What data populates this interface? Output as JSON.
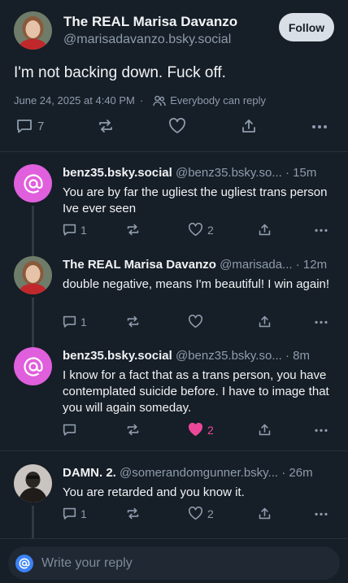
{
  "main_post": {
    "display_name": "The REAL Marisa Davanzo",
    "handle": "@marisadavanzo.bsky.social",
    "follow_label": "Follow",
    "text": "I'm not backing down. Fuck off.",
    "date": "June 24, 2025 at 4:40 PM",
    "reply_setting": "Everybody can reply",
    "reply_count": "7"
  },
  "replies": [
    {
      "display_name": "benz35.bsky.social",
      "handle": "@benz35.bsky.so...",
      "time": "· 15m",
      "text": "You are by far the ugliest the ugliest trans person Ive ever seen",
      "reply_count": "1",
      "like_count": "2",
      "avatar": "at-icon"
    },
    {
      "display_name": "The REAL Marisa Davanzo",
      "handle": "@marisada...",
      "time": "· 12m",
      "text": "double negative, means I'm beautiful! I win again!",
      "reply_count": "1",
      "like_count": "",
      "avatar": "photo"
    },
    {
      "display_name": "benz35.bsky.social",
      "handle": "@benz35.bsky.so...",
      "time": "· 8m",
      "text": "I know for a fact that as a trans person, you have contemplated suicide before. I have to image that you will again someday.",
      "reply_count": "",
      "like_count": "2",
      "liked": true,
      "avatar": "at-icon"
    },
    {
      "display_name": "DAMN. 2.",
      "handle": "@somerandomgunner.bsky...",
      "time": "· 26m",
      "text": "You are retarded and you know it.",
      "reply_count": "1",
      "like_count": "2",
      "avatar": "photo"
    }
  ],
  "compose": {
    "placeholder": "Write your reply"
  },
  "colors": {
    "background": "#161e27",
    "accent_like": "#ec4899",
    "muted": "#8e9cad",
    "at_avatar": "#e05fdc"
  }
}
